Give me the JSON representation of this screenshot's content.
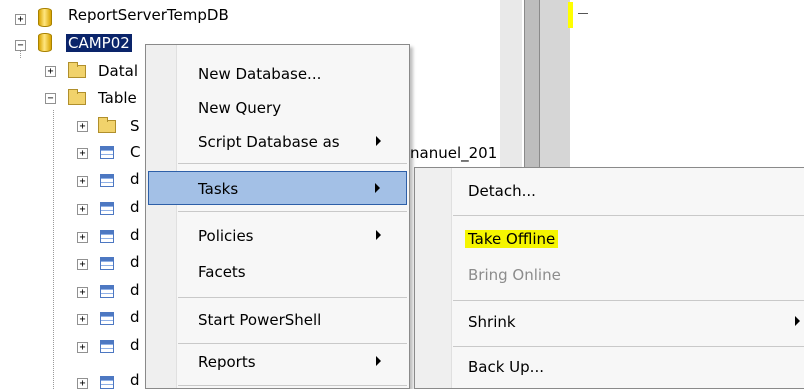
{
  "tree": {
    "report_temp_db": "ReportServerTempDB",
    "camp02": "CAMP02",
    "databases_folder": "Datal",
    "tables_folder": "Table",
    "system_tables": "S",
    "table_c": "C",
    "table_d": "d",
    "expand_sign": "+",
    "collapse_sign": "−"
  },
  "background": {
    "partial_text": "nanuel_201"
  },
  "context_menu": {
    "items": [
      {
        "label": "New Database..."
      },
      {
        "label": "New Query"
      },
      {
        "label": "Script Database as",
        "has_submenu": true
      },
      {
        "label": "Tasks",
        "has_submenu": true,
        "selected": true
      },
      {
        "label": "Policies",
        "has_submenu": true
      },
      {
        "label": "Facets"
      },
      {
        "label": "Start PowerShell"
      },
      {
        "label": "Reports",
        "has_submenu": true
      }
    ]
  },
  "tasks_submenu": {
    "items": [
      {
        "label": "Detach..."
      },
      {
        "label": "Take Offline",
        "highlight_color": "#f5f500"
      },
      {
        "label": "Bring Online",
        "disabled": true
      },
      {
        "label": "Shrink",
        "has_submenu": true
      },
      {
        "label": "Back Up..."
      }
    ]
  },
  "colors": {
    "selection": "#a3c0e6",
    "selection_border": "#2d5fa8",
    "highlighter": "#f5f500",
    "node_selected": "#0a246a"
  }
}
